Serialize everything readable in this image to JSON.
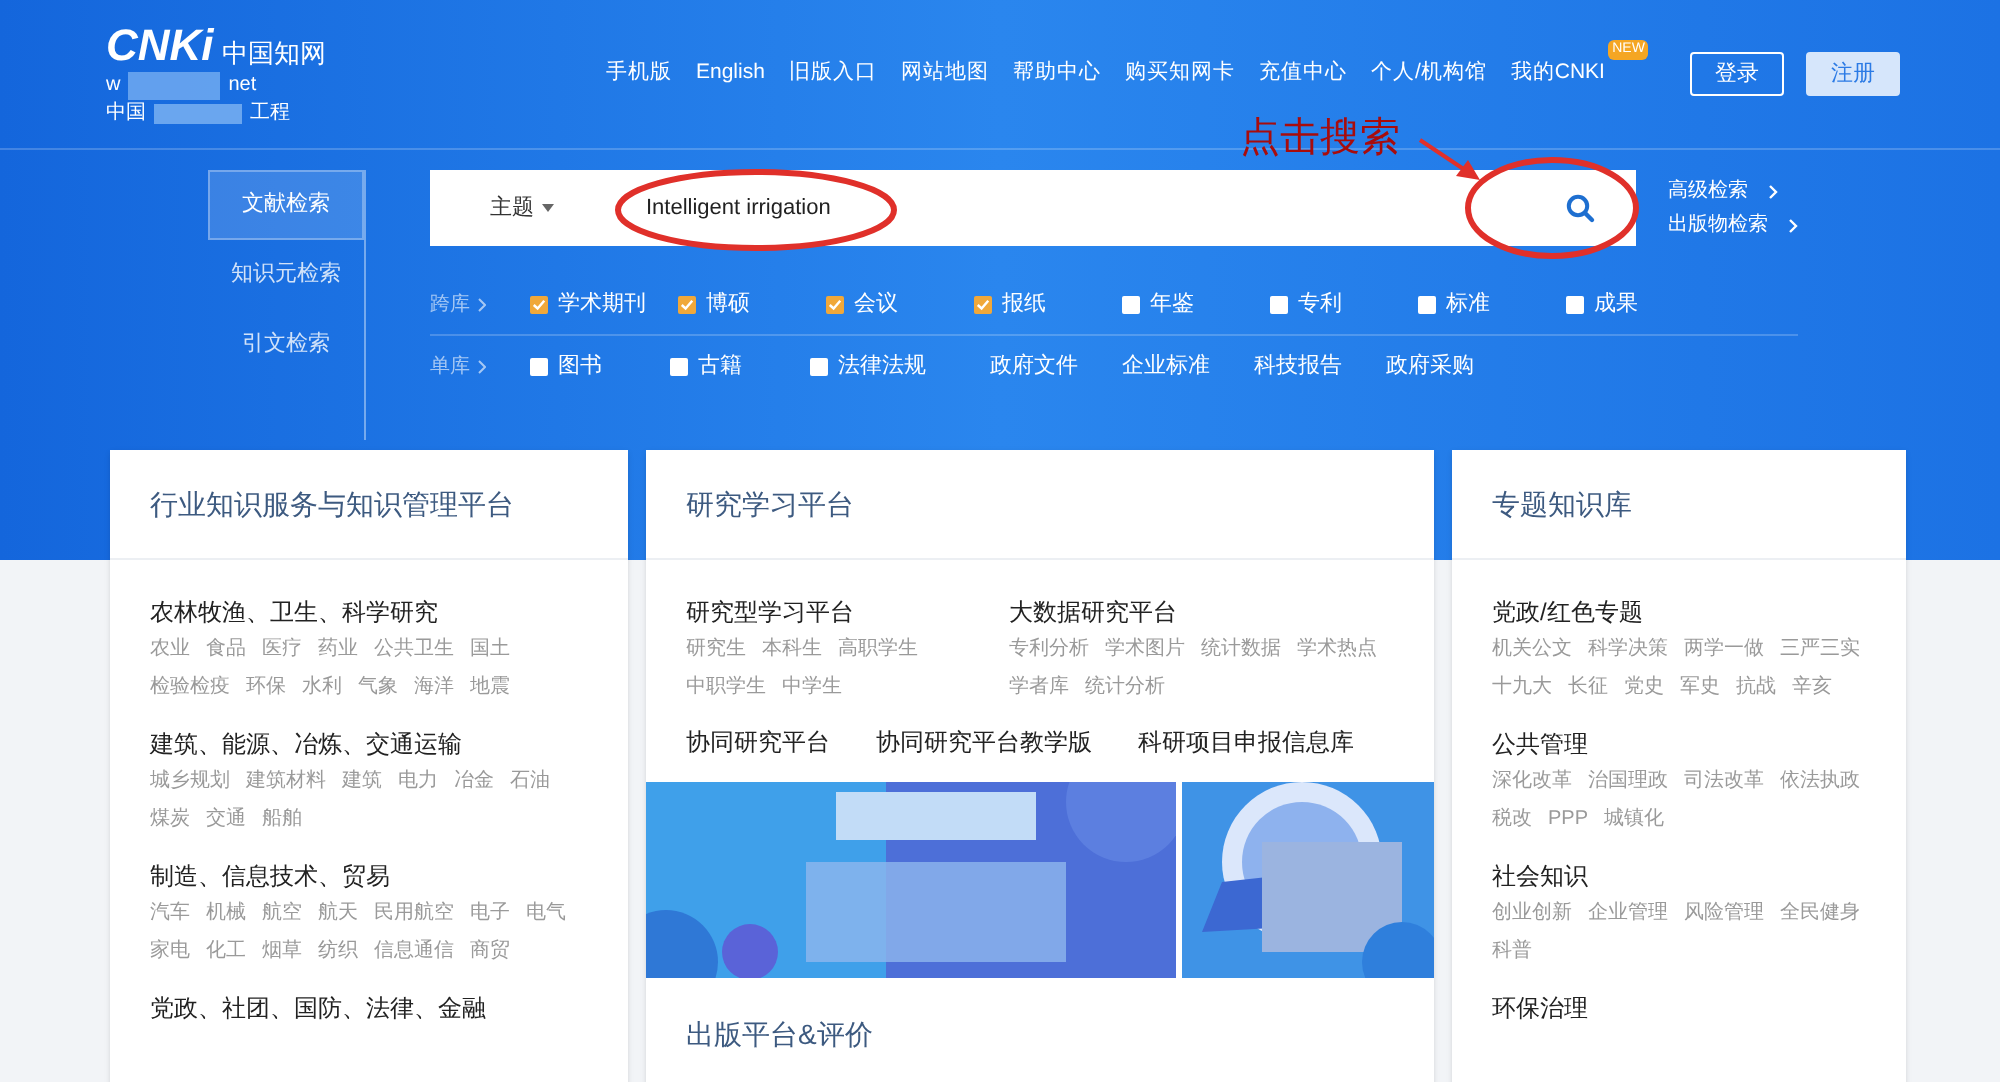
{
  "header": {
    "logo": {
      "mark": "CNKi",
      "name": "中国知网",
      "url_start": "w",
      "url_end": "net",
      "tagline_start": "中国",
      "tagline_end": "工程"
    },
    "nav": [
      {
        "label": "手机版"
      },
      {
        "label": "English"
      },
      {
        "label": "旧版入口"
      },
      {
        "label": "网站地图"
      },
      {
        "label": "帮助中心"
      },
      {
        "label": "购买知网卡"
      },
      {
        "label": "充值中心"
      },
      {
        "label": "个人/机构馆"
      },
      {
        "label": "我的CNKI",
        "badge": "NEW"
      }
    ],
    "buttons": [
      {
        "label": "登录",
        "kind": "outline"
      },
      {
        "label": "注册",
        "kind": "filled"
      }
    ]
  },
  "search": {
    "tabs": [
      {
        "label": "文献检索",
        "selected": true
      },
      {
        "label": "知识元检索",
        "selected": false
      },
      {
        "label": "引文检索",
        "selected": false
      }
    ],
    "field_dropdown": "主题",
    "query": "Intelligent irrigation",
    "side_links": [
      "高级检索",
      "出版物检索"
    ],
    "db_rows": [
      {
        "label": "跨库",
        "items": [
          {
            "kind": "checkbox",
            "label": "学术期刊",
            "checked": true
          },
          {
            "kind": "checkbox",
            "label": "博硕",
            "checked": true
          },
          {
            "kind": "checkbox",
            "label": "会议",
            "checked": true
          },
          {
            "kind": "checkbox",
            "label": "报纸",
            "checked": true
          },
          {
            "kind": "checkbox",
            "label": "年鉴",
            "checked": false
          },
          {
            "kind": "checkbox",
            "label": "专利",
            "checked": false
          },
          {
            "kind": "checkbox",
            "label": "标准",
            "checked": false
          },
          {
            "kind": "checkbox",
            "label": "成果",
            "checked": false
          }
        ]
      },
      {
        "label": "单库",
        "items": [
          {
            "kind": "checkbox",
            "label": "图书",
            "checked": false
          },
          {
            "kind": "checkbox",
            "label": "古籍",
            "checked": false
          },
          {
            "kind": "checkbox",
            "label": "法律法规",
            "checked": false
          },
          {
            "kind": "link",
            "label": "政府文件"
          },
          {
            "kind": "link",
            "label": "企业标准"
          },
          {
            "kind": "link",
            "label": "科技报告"
          },
          {
            "kind": "link",
            "label": "政府采购"
          }
        ]
      }
    ]
  },
  "annotation": {
    "label": "点击搜索"
  },
  "panels": [
    {
      "title": "行业知识服务与知识管理平台",
      "sections": [
        {
          "heading": "农林牧渔、卫生、科学研究",
          "links": [
            "农业",
            "食品",
            "医疗",
            "药业",
            "公共卫生",
            "国土",
            "检验检疫",
            "环保",
            "水利",
            "气象",
            "海洋",
            "地震"
          ]
        },
        {
          "heading": "建筑、能源、冶炼、交通运输",
          "links": [
            "城乡规划",
            "建筑材料",
            "建筑",
            "电力",
            "冶金",
            "石油",
            "煤炭",
            "交通",
            "船舶"
          ]
        },
        {
          "heading": "制造、信息技术、贸易",
          "links": [
            "汽车",
            "机械",
            "航空",
            "航天",
            "民用航空",
            "电子",
            "电气",
            "家电",
            "化工",
            "烟草",
            "纺织",
            "信息通信",
            "商贸"
          ]
        },
        {
          "heading": "党政、社团、国防、法律、金融"
        }
      ]
    },
    {
      "title": "研究学习平台",
      "columns": [
        {
          "heading": "研究型学习平台",
          "links": [
            "研究生",
            "本科生",
            "高职学生",
            "中职学生",
            "中学生"
          ]
        },
        {
          "heading": "大数据研究平台",
          "links": [
            "专利分析",
            "学术图片",
            "统计数据",
            "学术热点",
            "学者库",
            "统计分析"
          ]
        }
      ],
      "platforms": [
        "协同研究平台",
        "协同研究平台教学版",
        "科研项目申报信息库"
      ],
      "banners": [
        {
          "kind": "picture"
        },
        {
          "kind": "picture"
        }
      ],
      "subtitle": "出版平台&评价"
    },
    {
      "title": "专题知识库",
      "sections": [
        {
          "heading": "党政/红色专题",
          "links": [
            "机关公文",
            "科学决策",
            "两学一做",
            "三严三实",
            "十九大",
            "长征",
            "党史",
            "军史",
            "抗战",
            "辛亥"
          ]
        },
        {
          "heading": "公共管理",
          "links": [
            "深化改革",
            "治国理政",
            "司法改革",
            "依法执政",
            "税改",
            "PPP",
            "城镇化"
          ]
        },
        {
          "heading": "社会知识",
          "links": [
            "创业创新",
            "企业管理",
            "风险管理",
            "全民健身",
            "科普"
          ]
        },
        {
          "heading": "环保治理"
        }
      ]
    }
  ]
}
